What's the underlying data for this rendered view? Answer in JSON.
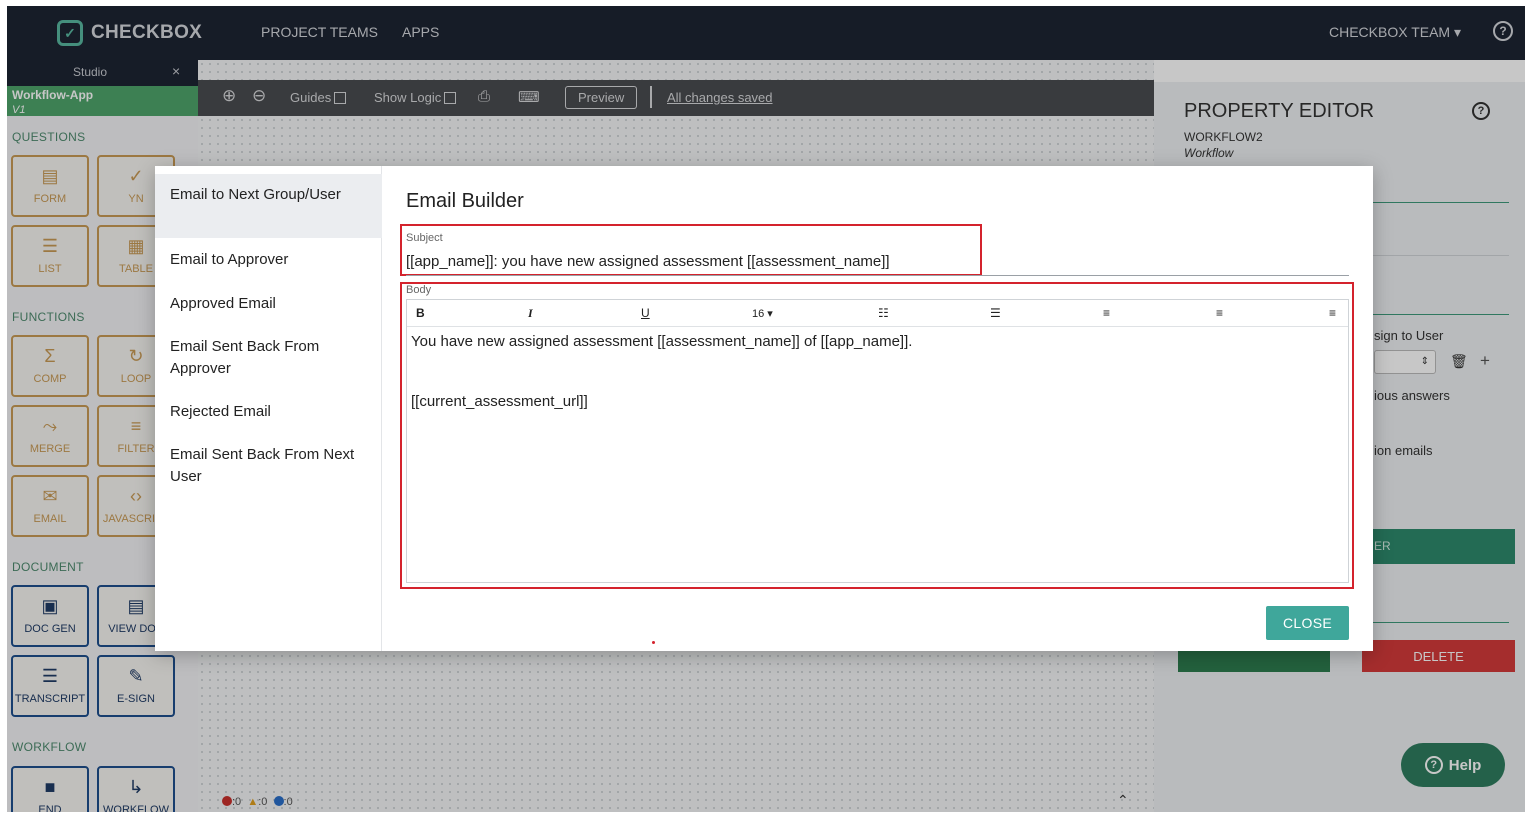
{
  "nav": {
    "logo": "CHECKBOX",
    "links": [
      "PROJECT TEAMS",
      "APPS"
    ],
    "team_menu": "CHECKBOX TEAM ▾",
    "help": "?"
  },
  "sidebar": {
    "studio_tab": "Studio",
    "close": "×",
    "app_name": "Workflow-App",
    "app_version": "V1",
    "sections": {
      "questions": "QUESTIONS",
      "functions": "FUNCTIONS",
      "document": "DOCUMENT",
      "workflow": "WORKFLOW"
    },
    "tools": {
      "form": "FORM",
      "yn": "YN",
      "list": "LIST",
      "table": "TABLE",
      "comp": "COMP",
      "loop": "LOOP",
      "merge": "MERGE",
      "filter": "FILTER",
      "email": "EMAIL",
      "javascript": "JAVASCRIPT",
      "doc_gen": "DOC GEN",
      "view_doc": "VIEW DOC",
      "transcript": "TRANSCRIPT",
      "e_sign": "E-SIGN",
      "end": "END",
      "workflow": "WORKFLOW"
    }
  },
  "canvas_toolbar": {
    "zoom_in": "⊕",
    "zoom_out": "⊖",
    "guides_label": "Guides",
    "show_logic_label": "Show Logic",
    "preview_label": "Preview",
    "saved_status": "All changes saved"
  },
  "status_bar": {
    "errors": ":0",
    "warnings": ":0",
    "info": ":0"
  },
  "property_editor": {
    "title": "PROPERTY EDITOR",
    "item_name": "WORKFLOW2",
    "item_type": "Workflow",
    "assign_label": "sign to User",
    "previous_answers": "ious answers",
    "emails_label": "ion emails",
    "green_button_partial": "ER",
    "delete_label": "DELETE"
  },
  "help_button": "Help",
  "modal": {
    "nav_items": [
      "Email to Next Group/User",
      "Email to Approver",
      "Approved Email",
      "Email Sent Back From Approver",
      "Rejected Email",
      "Email Sent Back From Next User"
    ],
    "title": "Email Builder",
    "subject_label": "Subject",
    "subject_value": "[[app_name]]: you have new assigned assessment [[assessment_name]]",
    "body_label": "Body",
    "toolbar": {
      "bold": "B",
      "italic": "I",
      "underline": "U",
      "font_size": "16 ▾"
    },
    "body_lines": [
      "You have new assigned assessment [[assessment_name]] of [[app_name]].",
      "",
      "[[current_assessment_url]]"
    ],
    "close_label": "CLOSE"
  }
}
